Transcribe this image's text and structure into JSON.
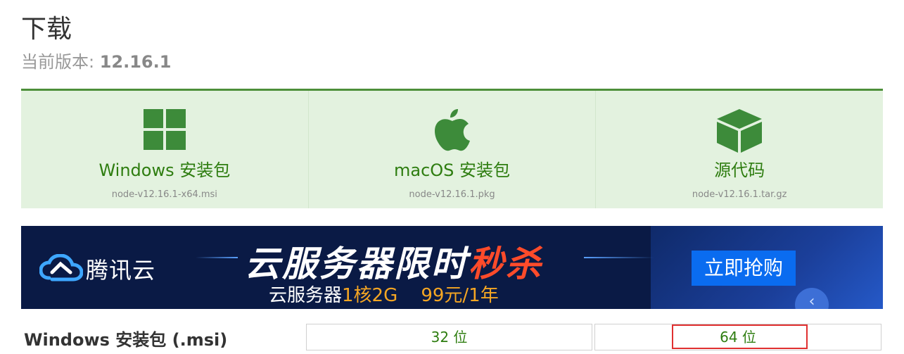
{
  "header": {
    "title": "下载",
    "version_label": "当前版本: ",
    "version_value": "12.16.1"
  },
  "downloads": [
    {
      "name": "Windows 安装包",
      "file": "node-v12.16.1-x64.msi",
      "icon": "windows-icon"
    },
    {
      "name": "macOS 安装包",
      "file": "node-v12.16.1.pkg",
      "icon": "apple-icon"
    },
    {
      "name": "源代码",
      "file": "node-v12.16.1.tar.gz",
      "icon": "cube-icon"
    }
  ],
  "banner": {
    "brand": "腾讯云",
    "headline_a": "云服务器限时",
    "headline_b": "秒杀",
    "sub_a": "云服务器",
    "sub_b": "1核2G",
    "sub_c": "99元/1年",
    "cta": "立即抢购",
    "colors": {
      "background": "#0a1a45",
      "button": "#0a6cf0",
      "accent": "#ff4b2a"
    }
  },
  "windows_row": {
    "label": "Windows 安装包 (.msi)",
    "btn_32": "32 位",
    "btn_64": "64 位"
  },
  "colors": {
    "accent_green": "#2e7d10",
    "panel_bg": "#e3f2df",
    "highlight": "#e03030"
  }
}
